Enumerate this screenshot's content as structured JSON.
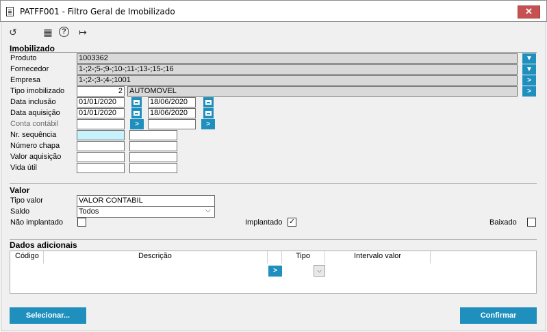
{
  "window": {
    "title": "PATFF001 - Filtro Geral de Imobilizado",
    "close_label": "✕"
  },
  "toolbar": {
    "refresh": "↺",
    "calendar": "▦",
    "help": "?",
    "exit": "↦"
  },
  "imobilizado": {
    "title": "Imobilizado",
    "produto": {
      "label": "Produto",
      "value": "1003362"
    },
    "fornecedor": {
      "label": "Fornecedor",
      "value": "1-;2-;5-;9-;10-;11-;13-;15-;16"
    },
    "empresa": {
      "label": "Empresa",
      "value": "1-;2-;3-;4-;1001"
    },
    "tipo": {
      "label": "Tipo imobilizado",
      "code": "2",
      "desc": "AUTOMOVEL"
    },
    "data_inclusao": {
      "label": "Data inclusão",
      "from": "01/01/2020",
      "to": "18/06/2020"
    },
    "data_aquisicao": {
      "label": "Data aquisição",
      "from": "01/01/2020",
      "to": "18/06/2020"
    },
    "conta_contabil": {
      "label": "Conta contábil"
    },
    "nr_sequencia": {
      "label": "Nr. sequência"
    },
    "numero_chapa": {
      "label": "Número chapa"
    },
    "valor_aquisicao": {
      "label": "Valor aquisição"
    },
    "vida_util": {
      "label": "Vida útil"
    }
  },
  "valor": {
    "title": "Valor",
    "tipo_valor": {
      "label": "Tipo valor",
      "value": "VALOR CONTABIL"
    },
    "saldo": {
      "label": "Saldo",
      "value": "Todos"
    },
    "nao_implantado": {
      "label": "Não implantado",
      "checked": false
    },
    "implantado": {
      "label": "Implantado",
      "checked": true,
      "mark": "✓"
    },
    "baixado": {
      "label": "Baixado",
      "checked": false
    }
  },
  "dados_adicionais": {
    "title": "Dados adicionais",
    "columns": [
      "Código",
      "Descrição",
      "Tipo",
      "Intervalo valor"
    ],
    "row_button": ">",
    "dropdown_icon": "⌵"
  },
  "buttons": {
    "selecionar": "Selecionar...",
    "confirmar": "Confirmar"
  },
  "icons": {
    "filter": "▼",
    "arrow": ">"
  }
}
